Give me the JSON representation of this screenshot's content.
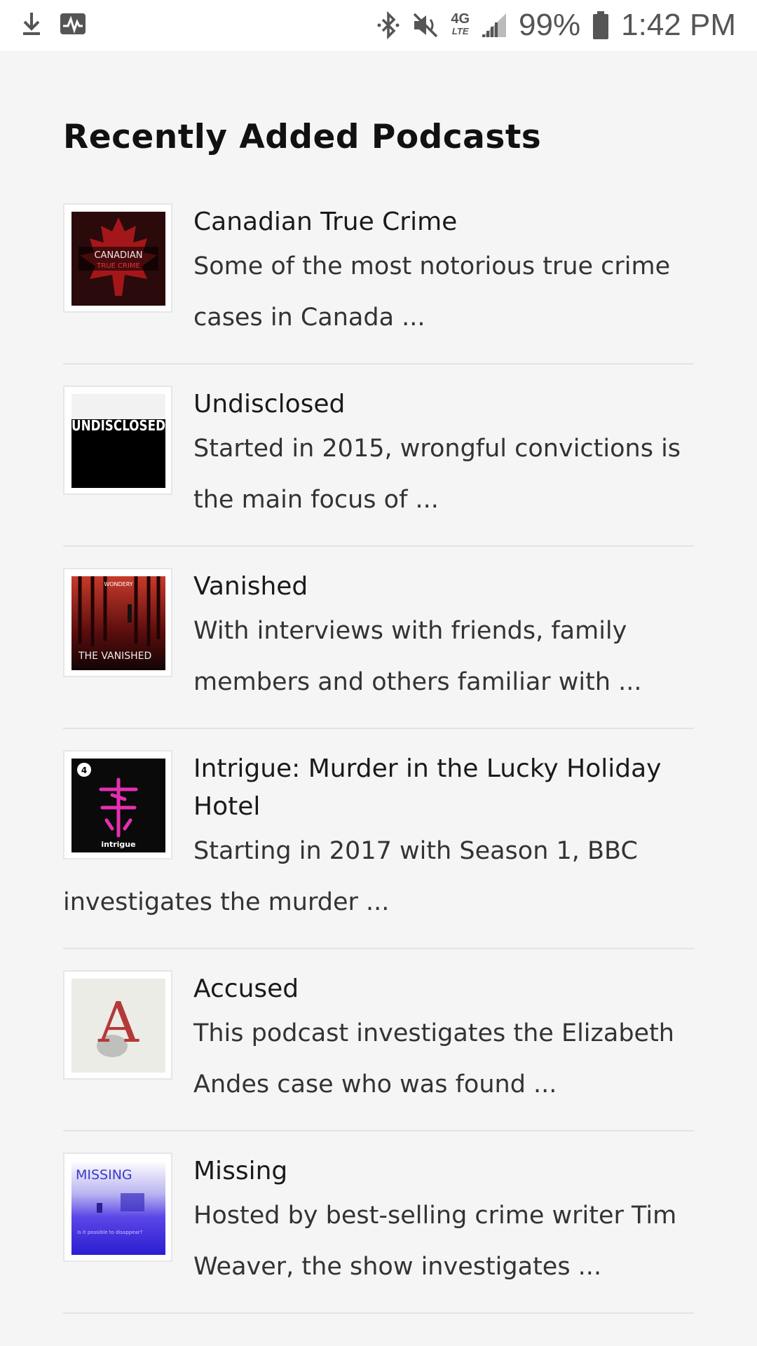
{
  "status_bar": {
    "battery": "99%",
    "time": "1:42 PM",
    "network": "4G",
    "network_sub": "LTE",
    "icons": [
      "download-icon",
      "activity-icon",
      "bluetooth-icon",
      "mute-icon",
      "signal-icon",
      "battery-icon"
    ]
  },
  "page": {
    "title": "Recently Added Podcasts"
  },
  "podcasts": [
    {
      "title": "Canadian True Crime",
      "description": "Some of the most notorious true crime cases in Canada ...",
      "art_text": "CANADIAN",
      "art_subtext": "TRUE CRIME"
    },
    {
      "title": "Undisclosed",
      "description": "Started in 2015, wrongful convictions is the main focus of ...",
      "art_text": "UNDISCLOSED"
    },
    {
      "title": "Vanished",
      "description": "With interviews with friends, family members and others familiar with ...",
      "art_text": "THE VANISHED",
      "art_subtext": "WONDERY"
    },
    {
      "title": "Intrigue: Murder in the Lucky Holiday Hotel",
      "description": "Starting in 2017 with Season 1, BBC investigates the murder ...",
      "art_text": "intrigue",
      "art_subtext": "4"
    },
    {
      "title": "Accused",
      "description": "This podcast investigates the Elizabeth Andes case who was found ...",
      "art_text": "A"
    },
    {
      "title": "Missing",
      "description": "Hosted by best-selling crime writer Tim Weaver, the show investigates ...",
      "art_text": "MISSING",
      "art_subtext": "Is it possible to disappear?"
    }
  ],
  "colors": {
    "background": "#f5f5f5",
    "divider": "#e4e4e4",
    "canadian_red": "#b01c1c",
    "intrigue_pink": "#e62fb0",
    "missing_blue": "#3b2fd8"
  }
}
